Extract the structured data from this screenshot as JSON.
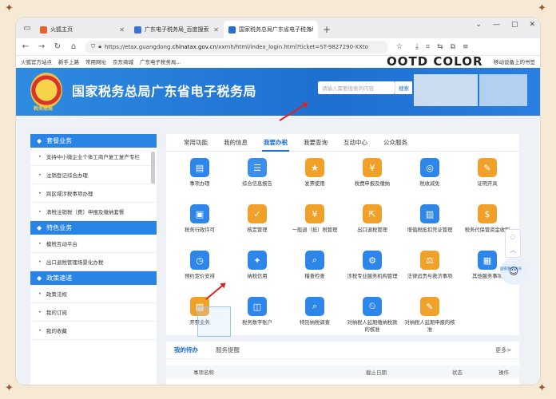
{
  "browser": {
    "tabs": [
      {
        "label": "火狐主页",
        "color": "#e8632b"
      },
      {
        "label": "广东电子税务局_百度搜索",
        "color": "#3b6fd9"
      },
      {
        "label": "国家税务总局广东省电子税务局",
        "color": "#2a6fd0"
      }
    ],
    "url_prefix": "https://etax.guangdong.",
    "url_domain": "chinatax.gov.cn",
    "url_suffix": "/xxmh/html/index_login.html?ticket=ST-9827290-XXto",
    "bookmarks": [
      "火狐官方站点",
      "新手上路",
      "常用网址",
      "京东商城",
      "广东电子税务局..."
    ],
    "bookmark_right": "移动设备上的书签"
  },
  "watermark": "OOTD COLOR",
  "site": {
    "title": "国家税务总局广东省电子税务局",
    "emblem_text": "税务总局",
    "search_placeholder": "请输入需要搜索的内容",
    "search_button": "搜索"
  },
  "sidebar": {
    "sections": [
      {
        "title": "套餐业务",
        "items": [
          "支持中小微企业个体工商户复工复产专栏",
          "注销登记综合办理",
          "跨区域涉税事项办理",
          "清税注销税（费）申报及缴纳套餐"
        ]
      },
      {
        "title": "特色业务",
        "items": [
          "模税互动平台",
          "出口退税管理场景化办税"
        ]
      },
      {
        "title": "政策速递",
        "items": [
          "政策法规",
          "我的订阅",
          "我的收藏"
        ]
      }
    ]
  },
  "main": {
    "tabs": [
      "常用功能",
      "我的信息",
      "我要办税",
      "我要查询",
      "互动中心",
      "公众服务"
    ],
    "active_tab": 2,
    "items": [
      {
        "label": "事项办理",
        "icon": "doc-icon",
        "color": "#2e86e8"
      },
      {
        "label": "综合信息报告",
        "icon": "report-icon",
        "color": "#3b8ee9"
      },
      {
        "label": "发票使用",
        "icon": "invoice-icon",
        "color": "#f0a12a"
      },
      {
        "label": "税费申报及缴纳",
        "icon": "declare-icon",
        "color": "#f0a12a"
      },
      {
        "label": "税收减免",
        "icon": "reduce-icon",
        "color": "#2e86e8"
      },
      {
        "label": "证明开具",
        "icon": "cert-icon",
        "color": "#f0a12a"
      },
      {
        "label": "税务行政许可",
        "icon": "license-icon",
        "color": "#2e86e8"
      },
      {
        "label": "核定管理",
        "icon": "verify-icon",
        "color": "#f0a12a"
      },
      {
        "label": "一般退（抵）税管理",
        "icon": "refund-icon",
        "color": "#f0a12a"
      },
      {
        "label": "出口退税管理",
        "icon": "export-icon",
        "color": "#f0a12a"
      },
      {
        "label": "增值税抵扣凭证管理",
        "icon": "vat-icon",
        "color": "#2e86e8"
      },
      {
        "label": "税务代保管资金收取",
        "icon": "fund-icon",
        "color": "#f0a12a"
      },
      {
        "label": "预约定价安排",
        "icon": "price-icon",
        "color": "#2e86e8"
      },
      {
        "label": "纳税信用",
        "icon": "credit-icon",
        "color": "#2e86e8"
      },
      {
        "label": "稽查检查",
        "icon": "inspect-icon",
        "color": "#2e86e8"
      },
      {
        "label": "涉税专业服务机构管理",
        "icon": "agency-icon",
        "color": "#2e86e8"
      },
      {
        "label": "法律追责与救济事项",
        "icon": "law-icon",
        "color": "#f0a12a"
      },
      {
        "label": "其他服务事项",
        "icon": "other-icon",
        "color": "#2e86e8"
      },
      {
        "label": "开票业务",
        "icon": "billing-icon",
        "color": "#f0a12a"
      },
      {
        "label": "税务数字账户",
        "icon": "account-icon",
        "color": "#2e86e8"
      },
      {
        "label": "特别纳税调查",
        "icon": "survey-icon",
        "color": "#2e86e8"
      },
      {
        "label": "对纳税人延期缴纳税款的核准",
        "icon": "delay-pay-icon",
        "color": "#2e86e8"
      },
      {
        "label": "对纳税人延期申报的核准",
        "icon": "delay-report-icon",
        "color": "#f0a12a"
      }
    ]
  },
  "todo": {
    "tabs": [
      "我的待办",
      "服务提醒"
    ],
    "more": "更多>",
    "columns": [
      "事项名称",
      "截止日期",
      "状态",
      "操作"
    ]
  },
  "float": {
    "ai_label": "国家税务总局"
  }
}
